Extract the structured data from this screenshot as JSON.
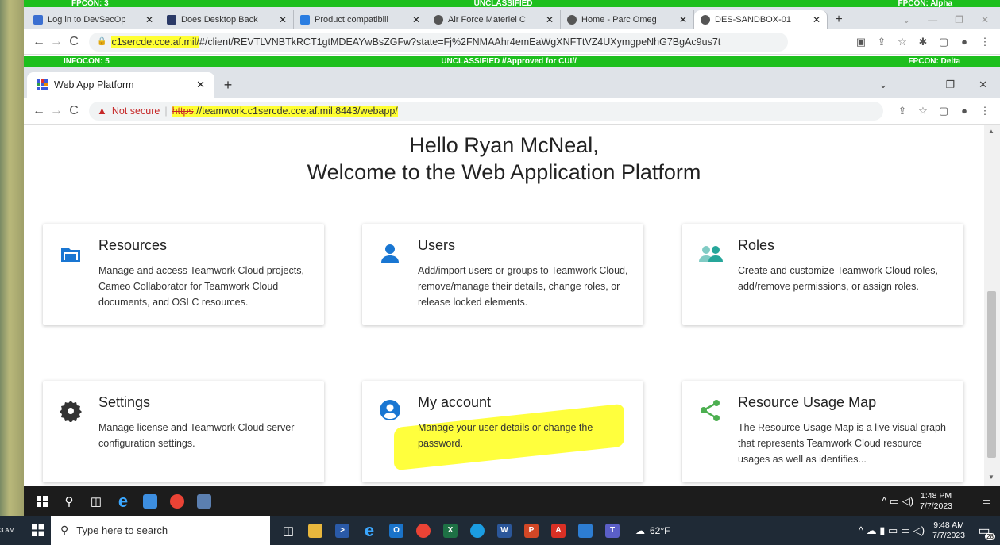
{
  "outer_banner": {
    "left": "FPCON: 3",
    "center": "UNCLASSIFIED",
    "right": "FPCON: Alpha"
  },
  "outer_browser": {
    "tabs": [
      {
        "title": "Log in to DevSecOp",
        "icon": "devsecops-icon",
        "color": "#3b6fd1",
        "active": false
      },
      {
        "title": "Does Desktop Back",
        "icon": "doc-icon",
        "color": "#2b3a67",
        "active": false
      },
      {
        "title": "Product compatibili",
        "icon": "nomagic-icon",
        "color": "#2a7de1",
        "active": false
      },
      {
        "title": "Air Force Materiel C",
        "icon": "globe-icon",
        "color": "#555555",
        "active": false
      },
      {
        "title": "Home - Parc Omeg",
        "icon": "globe-icon",
        "color": "#555555",
        "active": false
      },
      {
        "title": "DES-SANDBOX-01",
        "icon": "globe-icon",
        "color": "#555555",
        "active": true
      }
    ],
    "new_tab": "+",
    "url_domain": "c1sercde.cce.af.mil/",
    "url_rest": "#/client/REVTLVNBTkRCT1gtMDEAYwBsZGFw?state=Fj%2FNMAAhr4emEaWgXNFTtVZ4UXymgpeNhG7BgAc9us7t"
  },
  "inner_banner": {
    "left": "INFOCON: 5",
    "center": "UNCLASSIFIED //Approved for CUI//",
    "right": "FPCON: Delta"
  },
  "inner_browser": {
    "tab_title": "Web App Platform",
    "new_tab": "+",
    "security_label": "Not secure",
    "url_scheme": "https",
    "url_rest": "://teamwork.c1sercde.cce.af.mil:8443/webapp/"
  },
  "page": {
    "greeting": "Hello Ryan McNeal,",
    "welcome": "Welcome to the Web Application Platform",
    "cards": [
      {
        "title": "Resources",
        "desc": "Manage and access Teamwork Cloud projects, Cameo Collaborator for Teamwork Cloud documents, and OSLC resources.",
        "icon": "folder-icon",
        "color": "#1976d2"
      },
      {
        "title": "Users",
        "desc": "Add/import users or groups to Teamwork Cloud, remove/manage their details, change roles, or release locked elements.",
        "icon": "user-icon",
        "color": "#1976d2"
      },
      {
        "title": "Roles",
        "desc": "Create and customize Teamwork Cloud roles, add/remove permissions, or assign roles.",
        "icon": "roles-icon",
        "color": "#26a69a"
      },
      {
        "title": "Settings",
        "desc": "Manage license and Teamwork Cloud server configuration settings.",
        "icon": "gear-icon",
        "color": "#333333"
      },
      {
        "title": "My account",
        "desc": "Manage your user details or change the password.",
        "icon": "account-circle-icon",
        "color": "#1976d2"
      },
      {
        "title": "Resource Usage Map",
        "desc": "The Resource Usage Map is a live visual graph that represents Teamwork Cloud resource usages as well as identifies...",
        "icon": "share-icon",
        "color": "#4caf50"
      }
    ]
  },
  "inner_taskbar": {
    "time": "1:48 PM",
    "date": "7/7/2023"
  },
  "outer_taskbar": {
    "search_placeholder": "Type here to search",
    "weather": "62°F",
    "time": "9:48 AM",
    "date": "7/7/2023",
    "notifications": "28",
    "left_clip_time": "3 AM"
  }
}
